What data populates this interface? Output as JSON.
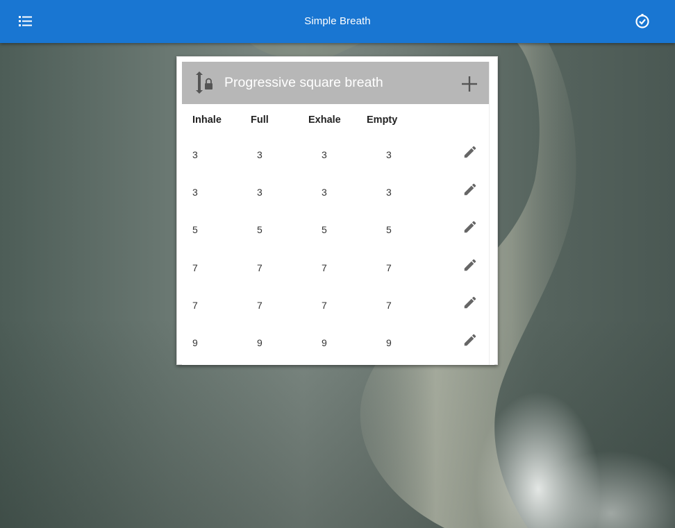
{
  "app": {
    "title": "Simple Breath",
    "menu_icon": "list-menu-icon",
    "timer_icon": "timer-icon",
    "accent_color": "#1976d2"
  },
  "card": {
    "title": "Progressive square breath",
    "lock_icon": "height-lock-icon",
    "add_icon": "plus-icon",
    "header_color": "#b7b7b7",
    "columns": [
      "Inhale",
      "Full",
      "Exhale",
      "Empty"
    ],
    "rows": [
      {
        "inhale": "3",
        "full": "3",
        "exhale": "3",
        "empty": "3"
      },
      {
        "inhale": "3",
        "full": "3",
        "exhale": "3",
        "empty": "3"
      },
      {
        "inhale": "5",
        "full": "5",
        "exhale": "5",
        "empty": "5"
      },
      {
        "inhale": "7",
        "full": "7",
        "exhale": "7",
        "empty": "7"
      },
      {
        "inhale": "7",
        "full": "7",
        "exhale": "7",
        "empty": "7"
      },
      {
        "inhale": "9",
        "full": "9",
        "exhale": "9",
        "empty": "9"
      }
    ],
    "edit_icon": "pencil-icon"
  }
}
